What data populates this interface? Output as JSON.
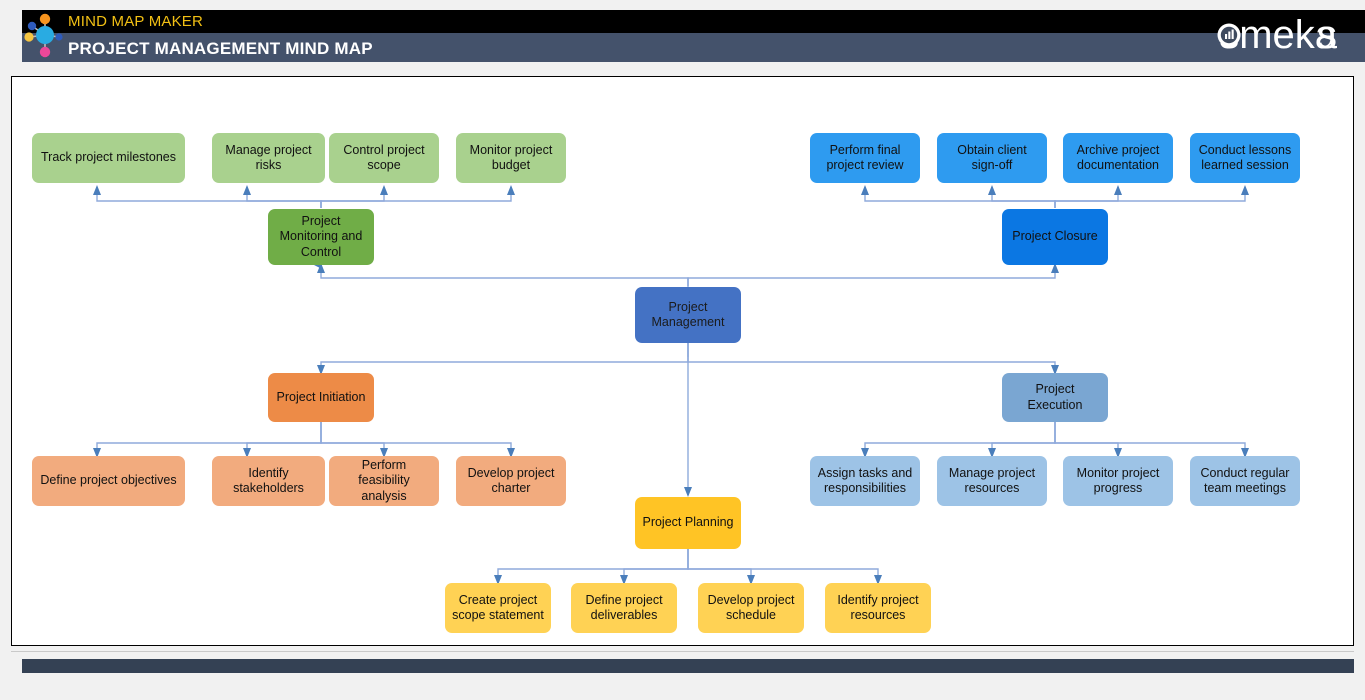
{
  "header": {
    "tagline": "MIND MAP MAKER",
    "title": "PROJECT MANAGEMENT MIND MAP",
    "brand": "someka",
    "logo_icon": "mindmap-node-logo-icon",
    "brand_icon": "bar-chart-icon",
    "colors": {
      "top_band": "#000000",
      "title_band": "#44526b",
      "tagline_text": "#f2c014",
      "title_text": "#ffffff",
      "footer_bar": "#344154"
    }
  },
  "chart_data": {
    "type": "diagram",
    "title": "PROJECT MANAGEMENT MIND MAP",
    "diagram_kind": "mind-map",
    "connector_color": "#8faadc",
    "root": {
      "label": "Project Management",
      "fill": "#4472c4",
      "text_color": "#1b1b1b"
    },
    "branches": [
      {
        "id": "monitoring",
        "label": "Project Monitoring and Control",
        "fill": "#70ad47",
        "direction": "up-left",
        "children": [
          "Track project milestones",
          "Manage project risks",
          "Control project scope",
          "Monitor project budget"
        ],
        "child_fill": "#a9d18e"
      },
      {
        "id": "closure",
        "label": "Project Closure",
        "fill": "#0b77e3",
        "direction": "up-right",
        "children": [
          "Perform final project review",
          "Obtain client sign-off",
          "Archive project documentation",
          "Conduct lessons learned session"
        ],
        "child_fill": "#2e9bf0"
      },
      {
        "id": "initiation",
        "label": "Project Initiation",
        "fill": "#ed8b47",
        "direction": "down-left",
        "children": [
          "Define project objectives",
          "Identify stakeholders",
          "Perform feasibility analysis",
          "Develop project charter"
        ],
        "child_fill": "#f2ab7e"
      },
      {
        "id": "execution",
        "label": "Project Execution",
        "fill": "#7aa6d2",
        "direction": "down-right",
        "children": [
          "Assign tasks and responsibilities",
          "Manage project resources",
          "Monitor project progress",
          "Conduct regular team meetings"
        ],
        "child_fill": "#9dc3e6"
      },
      {
        "id": "planning",
        "label": "Project Planning",
        "fill": "#ffc425",
        "direction": "down-center",
        "children": [
          "Create project scope statement",
          "Define project deliverables",
          "Develop project schedule",
          "Identify project resources"
        ],
        "child_fill": "#ffd254"
      }
    ]
  },
  "nodes": {
    "root": {
      "label": "Project Management"
    },
    "monitoring": {
      "label": "Project Monitoring and Control"
    },
    "monitoring_children": [
      {
        "label": "Track project milestones"
      },
      {
        "label": "Manage project risks"
      },
      {
        "label": "Control project scope"
      },
      {
        "label": "Monitor project budget"
      }
    ],
    "closure": {
      "label": "Project Closure"
    },
    "closure_children": [
      {
        "label": "Perform final project review"
      },
      {
        "label": "Obtain client sign-off"
      },
      {
        "label": "Archive project documentation"
      },
      {
        "label": "Conduct lessons learned session"
      }
    ],
    "initiation": {
      "label": "Project Initiation"
    },
    "initiation_children": [
      {
        "label": "Define project objectives"
      },
      {
        "label": "Identify stakeholders"
      },
      {
        "label": "Perform feasibility analysis"
      },
      {
        "label": "Develop project charter"
      }
    ],
    "execution": {
      "label": "Project Execution"
    },
    "execution_children": [
      {
        "label": "Assign tasks and responsibilities"
      },
      {
        "label": "Manage project resources"
      },
      {
        "label": "Monitor project progress"
      },
      {
        "label": "Conduct regular team meetings"
      }
    ],
    "planning": {
      "label": "Project Planning"
    },
    "planning_children": [
      {
        "label": "Create project scope statement"
      },
      {
        "label": "Define project deliverables"
      },
      {
        "label": "Develop project schedule"
      },
      {
        "label": "Identify project resources"
      }
    ]
  }
}
